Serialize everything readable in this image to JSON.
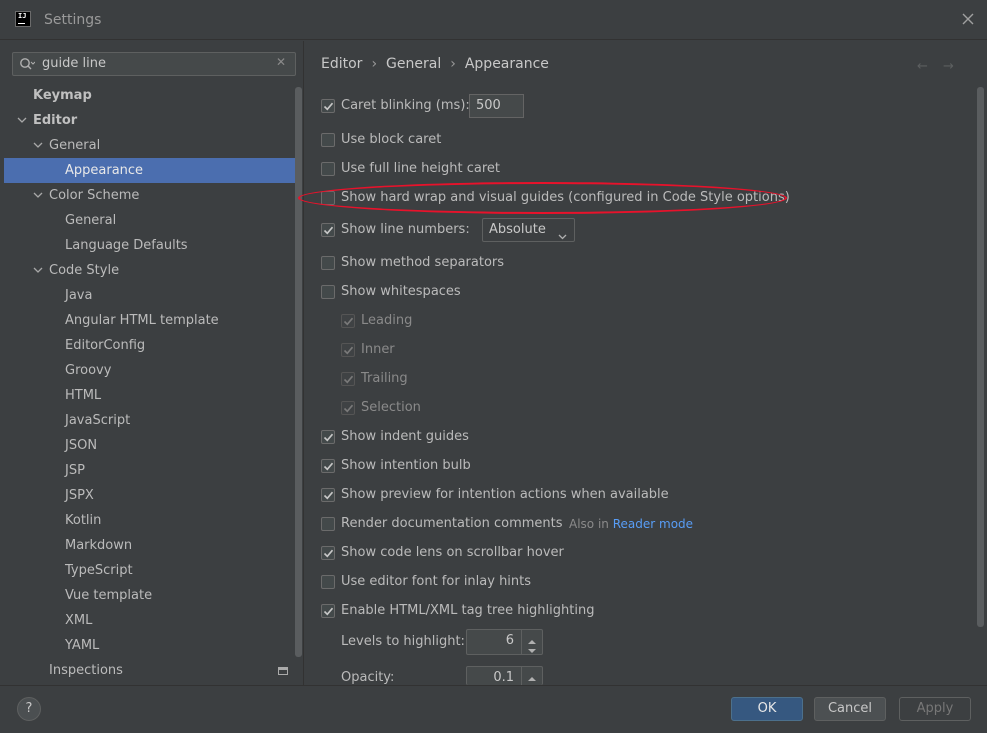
{
  "window": {
    "title": "Settings"
  },
  "search": {
    "value": "guide line"
  },
  "tree": {
    "items": [
      {
        "label": "Keymap",
        "level": 0,
        "bold": true,
        "expanded": null
      },
      {
        "label": "Editor",
        "level": 0,
        "bold": true,
        "expanded": true
      },
      {
        "label": "General",
        "level": 1,
        "expanded": true
      },
      {
        "label": "Appearance",
        "level": 2,
        "selected": true
      },
      {
        "label": "Color Scheme",
        "level": 1,
        "expanded": true
      },
      {
        "label": "General",
        "level": 2
      },
      {
        "label": "Language Defaults",
        "level": 2
      },
      {
        "label": "Code Style",
        "level": 1,
        "expanded": true
      },
      {
        "label": "Java",
        "level": 2
      },
      {
        "label": "Angular HTML template",
        "level": 2
      },
      {
        "label": "EditorConfig",
        "level": 2
      },
      {
        "label": "Groovy",
        "level": 2
      },
      {
        "label": "HTML",
        "level": 2
      },
      {
        "label": "JavaScript",
        "level": 2
      },
      {
        "label": "JSON",
        "level": 2
      },
      {
        "label": "JSP",
        "level": 2
      },
      {
        "label": "JSPX",
        "level": 2
      },
      {
        "label": "Kotlin",
        "level": 2
      },
      {
        "label": "Markdown",
        "level": 2
      },
      {
        "label": "TypeScript",
        "level": 2
      },
      {
        "label": "Vue template",
        "level": 2
      },
      {
        "label": "XML",
        "level": 2
      },
      {
        "label": "YAML",
        "level": 2
      },
      {
        "label": "Inspections",
        "level": 1
      }
    ]
  },
  "breadcrumb": [
    "Editor",
    "General",
    "Appearance"
  ],
  "options": {
    "caret_blinking": {
      "label": "Caret blinking (ms):",
      "checked": true,
      "value": "500"
    },
    "block_caret": {
      "label": "Use block caret",
      "checked": false
    },
    "full_line_caret": {
      "label": "Use full line height caret",
      "checked": false
    },
    "hard_wrap": {
      "label": "Show hard wrap and visual guides (configured in Code Style options)",
      "checked": false
    },
    "line_numbers": {
      "label": "Show line numbers:",
      "checked": true,
      "dropdown": "Absolute"
    },
    "method_separators": {
      "label": "Show method separators",
      "checked": false
    },
    "whitespaces": {
      "label": "Show whitespaces",
      "checked": false
    },
    "leading": {
      "label": "Leading",
      "checked": true
    },
    "inner": {
      "label": "Inner",
      "checked": true
    },
    "trailing": {
      "label": "Trailing",
      "checked": true
    },
    "selection": {
      "label": "Selection",
      "checked": true
    },
    "indent_guides": {
      "label": "Show indent guides",
      "checked": true
    },
    "intention_bulb": {
      "label": "Show intention bulb",
      "checked": true
    },
    "preview_intention": {
      "label": "Show preview for intention actions when available",
      "checked": true
    },
    "render_docs": {
      "label": "Render documentation comments",
      "checked": false,
      "also_in": "Also in",
      "link": "Reader mode"
    },
    "code_lens": {
      "label": "Show code lens on scrollbar hover",
      "checked": true
    },
    "editor_font_inlay": {
      "label": "Use editor font for inlay hints",
      "checked": false
    },
    "tag_tree": {
      "label": "Enable HTML/XML tag tree highlighting",
      "checked": true
    },
    "levels": {
      "label": "Levels to highlight:",
      "value": "6"
    },
    "opacity": {
      "label": "Opacity:",
      "value": "0.1"
    }
  },
  "buttons": {
    "help": "?",
    "ok": "OK",
    "cancel": "Cancel",
    "apply": "Apply"
  },
  "colors": {
    "accent": "#4b6eaf",
    "primary_button": "#365880",
    "highlight": "#e8122b",
    "link": "#589df6"
  }
}
